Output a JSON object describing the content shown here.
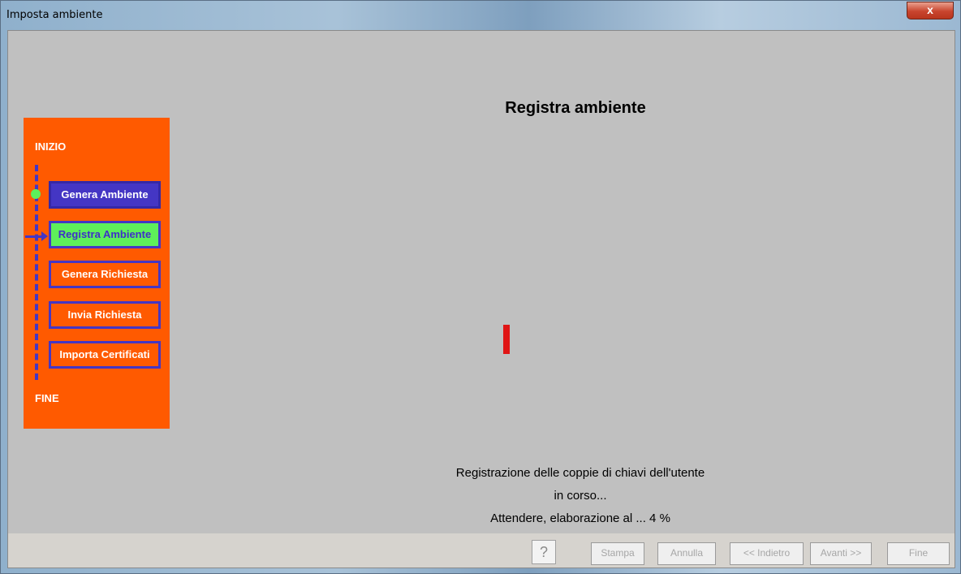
{
  "window": {
    "title": "Imposta ambiente",
    "close_label": "x"
  },
  "main": {
    "heading": "Registra ambiente",
    "status_line1": "Registrazione delle coppie di chiavi dell'utente",
    "status_line2": "in corso...",
    "status_line3": "Attendere, elaborazione al ... 4 %",
    "progress_percent": 4
  },
  "wizard": {
    "start_label": "INIZIO",
    "end_label": "FINE",
    "steps": [
      {
        "label": "Genera Ambiente",
        "state": "done"
      },
      {
        "label": "Registra Ambiente",
        "state": "active"
      },
      {
        "label": "Genera Richiesta",
        "state": "todo"
      },
      {
        "label": "Invia Richiesta",
        "state": "todo"
      },
      {
        "label": "Importa Certificati",
        "state": "todo"
      }
    ]
  },
  "buttons": {
    "help": "?",
    "stampa": "Stampa",
    "annulla": "Annulla",
    "indietro": "<< Indietro",
    "avanti": "Avanti >>",
    "fine": "Fine"
  },
  "colors": {
    "panel": "#ff5a00",
    "step_border": "#4436c4",
    "active_step": "#5ef05a",
    "progress": "#e01515",
    "client_bg": "#c0c0c0"
  }
}
